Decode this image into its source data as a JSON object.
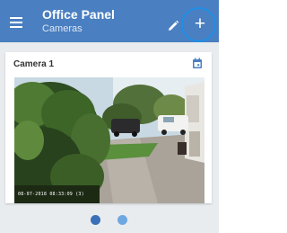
{
  "app_bar": {
    "title": "Office Panel",
    "subtitle": "Cameras",
    "menu_icon": "hamburger-menu-icon",
    "edit_icon": "pencil-icon",
    "add_icon": "plus-icon",
    "add_label": "+"
  },
  "camera_card": {
    "title": "Camera 1",
    "calendar_icon": "calendar-icon",
    "timestamp": "08-07-2018 08:33:09 (3)"
  },
  "pager": {
    "pages": 2,
    "active_page": 1
  },
  "colors": {
    "app_bar": "#4a7fc1",
    "highlight_ring": "#1e8fe6",
    "page_background": "#e9ecef",
    "dot_active": "#3a6fb9",
    "dot_inactive": "#6fa8e1"
  }
}
